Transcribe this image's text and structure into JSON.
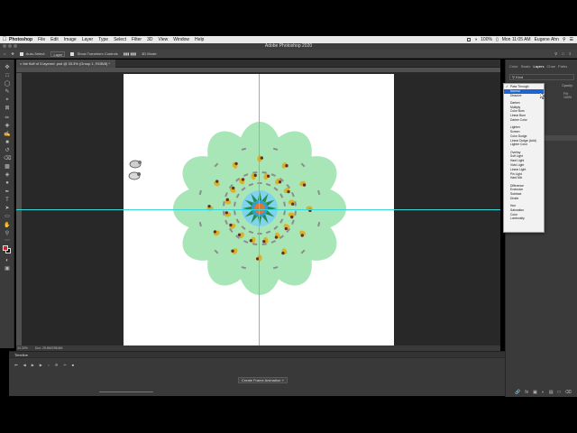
{
  "menubar": {
    "items": [
      "Photoshop",
      "File",
      "Edit",
      "Image",
      "Layer",
      "Type",
      "Select",
      "Filter",
      "3D",
      "View",
      "Window",
      "Help"
    ],
    "right": {
      "battery": "100%",
      "clock": "Mon 11:05 AM",
      "user": "Eugene Ahn"
    }
  },
  "window": {
    "title": "Adobe Photoshop 2020"
  },
  "options": {
    "auto_select_label": "Auto-Select:",
    "auto_select_value": "Layer",
    "transform_controls_label": "Show Transform Controls",
    "mode_3d": "3D Mode:"
  },
  "doc_tab": {
    "title": "the fluff of 3 layered .psd @ 33.3% (Group 1, RGB/8) *"
  },
  "status": {
    "zoom": "33.33%",
    "doc": "Doc: 25.8M/298.8M"
  },
  "timeline": {
    "title": "Timeline",
    "create_button": "Create Frame Animation"
  },
  "panels": {
    "tabs": [
      "Color",
      "Swatc",
      "Layers",
      "Chan",
      "Paths"
    ],
    "active_tab": "Layers",
    "kind_label": "Kind",
    "opacity_label": "Opacity:",
    "opacity_value": "100%",
    "fill_label": "Fill:",
    "fill_value": "100%"
  },
  "blend_modes": {
    "groups": [
      [
        "Pass Through",
        "Normal",
        "Dissolve"
      ],
      [
        "Darken",
        "Multiply",
        "Color Burn",
        "Linear Burn",
        "Darker Color"
      ],
      [
        "Lighten",
        "Screen",
        "Color Dodge",
        "Linear Dodge (Add)",
        "Lighter Color"
      ],
      [
        "Overlay",
        "Soft Light",
        "Hard Light",
        "Vivid Light",
        "Linear Light",
        "Pin Light",
        "Hard Mix"
      ],
      [
        "Difference",
        "Exclusion",
        "Subtract",
        "Divide"
      ],
      [
        "Hue",
        "Saturation",
        "Color",
        "Luminosity"
      ]
    ],
    "checked": "Pass Through",
    "highlighted": "Normal"
  },
  "colors": {
    "guide": "#3bd6d6",
    "mandala_fill": "#a8e6b8",
    "highlight": "#1e64d2",
    "foreground": "#c1272d"
  },
  "icons": {
    "tools": [
      "move-icon",
      "marquee-icon",
      "lasso-icon",
      "quick-select-icon",
      "crop-icon",
      "frame-icon",
      "eyedropper-icon",
      "healing-icon",
      "brush-icon",
      "clone-stamp-icon",
      "history-brush-icon",
      "eraser-icon",
      "gradient-icon",
      "blur-icon",
      "dodge-icon",
      "pen-icon",
      "type-icon",
      "path-select-icon",
      "shape-icon",
      "hand-icon",
      "zoom-icon",
      "more-tools-icon"
    ]
  }
}
